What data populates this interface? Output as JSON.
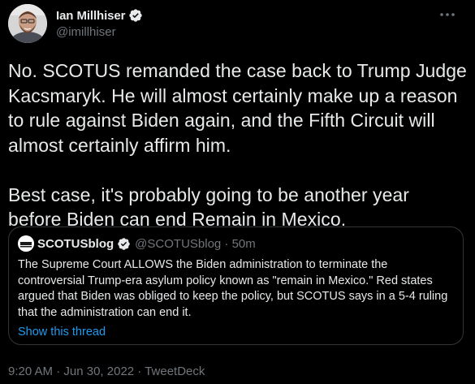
{
  "author": {
    "name": "Ian Millhiser",
    "handle": "@imillhiser",
    "verified_icon": "verified-badge-icon",
    "avatar": "profile-photo"
  },
  "more_icon": "more-horizontal-icon",
  "tweet": {
    "text": "No. SCOTUS remanded the case back to Trump Judge Kacsmaryk. He will almost certainly make up a reason to rule against Biden again, and the Fifth Circuit will almost certainly affirm him.\n\nBest case, it's probably going to be another year before Biden can end Remain in Mexico."
  },
  "quote": {
    "name": "SCOTUSblog",
    "handle_time": "@SCOTUSblog · 50m",
    "text": "The Supreme Court ALLOWS the Biden administration to terminate the controversial Trump-era asylum policy known as \"remain in Mexico.\" Red states argued that Biden was obliged to keep the policy, but SCOTUS says in a 5-4 ruling that the administration can end it.",
    "show_thread": "Show this thread",
    "avatar": "scotusblog-logo"
  },
  "footer": {
    "time": "9:20 AM",
    "sep1": " · ",
    "date": "Jun 30, 2022",
    "sep2": " · ",
    "source": "TweetDeck"
  },
  "colors": {
    "background": "#000000",
    "text": "#e7e9ea",
    "secondary": "#71767b",
    "accent": "#1d9bf0",
    "border": "#333639"
  }
}
